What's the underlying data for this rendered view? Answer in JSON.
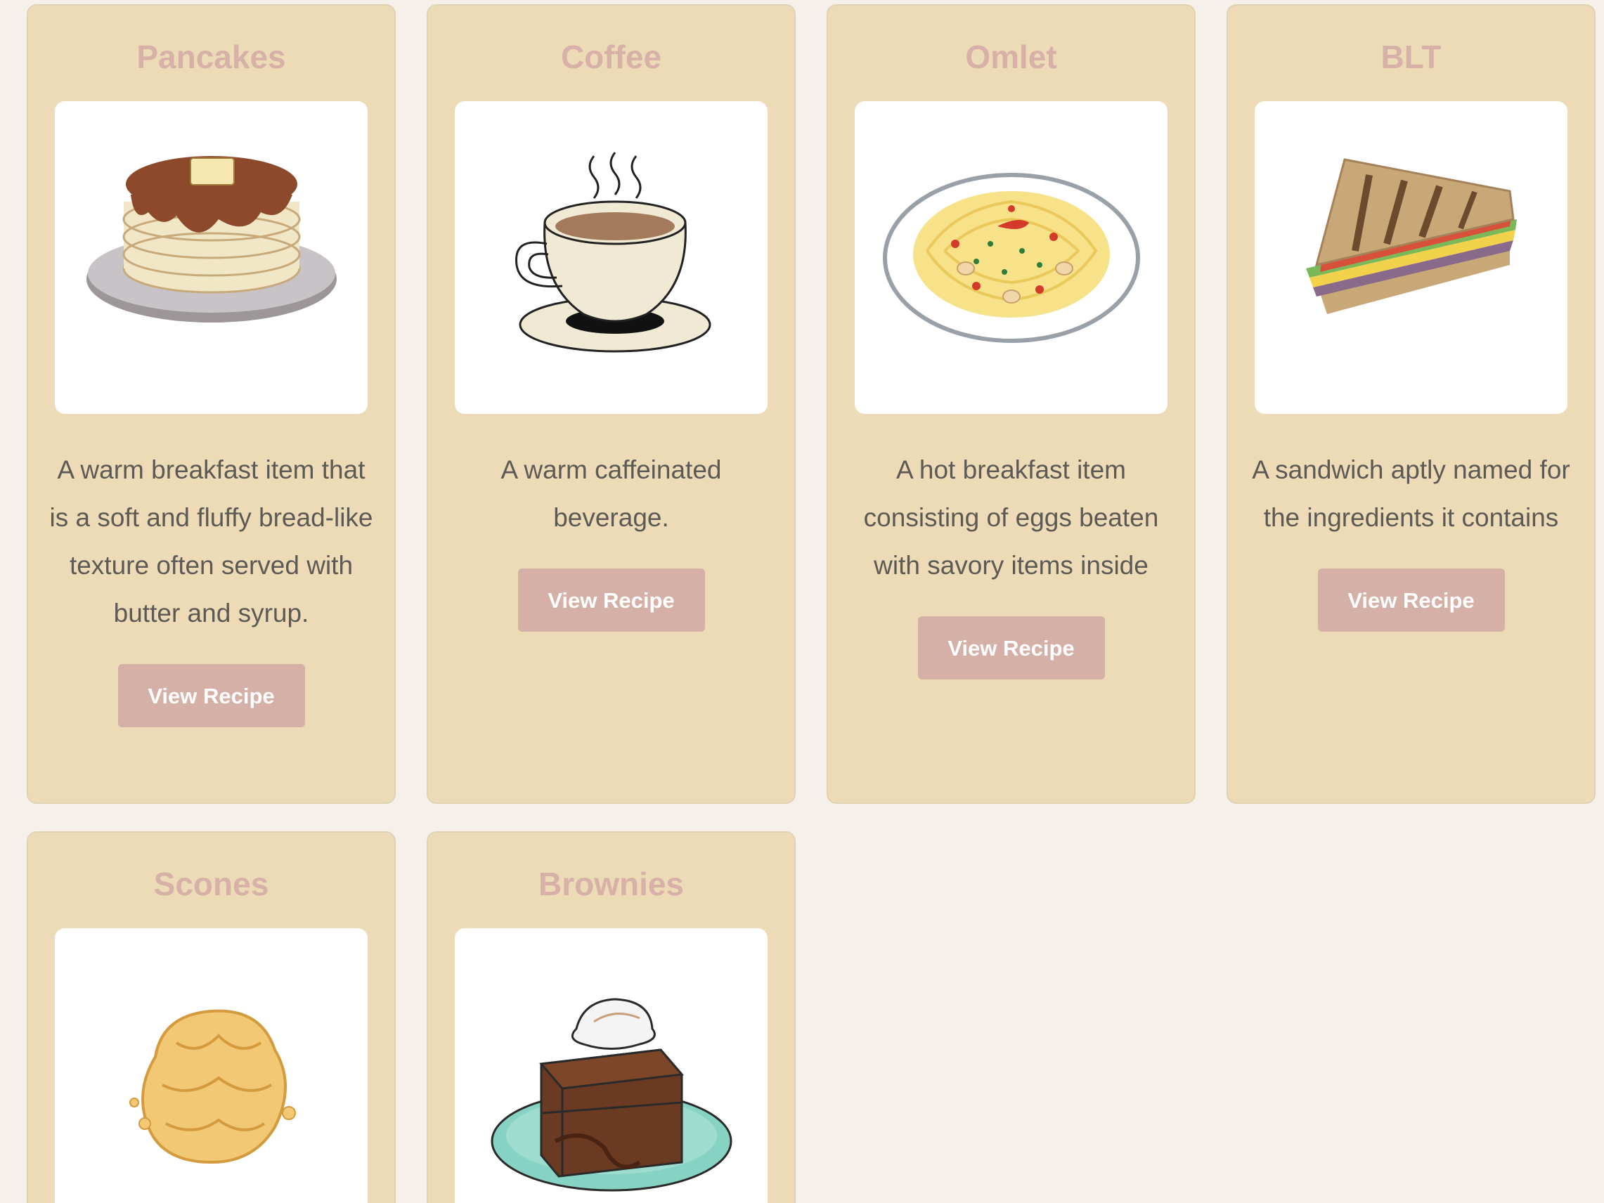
{
  "cards": [
    {
      "title": "Pancakes",
      "image_icon": "pancakes-icon",
      "description": "A warm breakfast item that is a soft and fluffy bread-like texture often served with butter and syrup.",
      "button_label": "View Recipe"
    },
    {
      "title": "Coffee",
      "image_icon": "coffee-cup-icon",
      "description": "A warm caffeinated beverage.",
      "button_label": "View Recipe"
    },
    {
      "title": "Omlet",
      "image_icon": "pasta-plate-icon",
      "description": "A hot breakfast item consisting of eggs beaten with savory items inside",
      "button_label": "View Recipe"
    },
    {
      "title": "BLT",
      "image_icon": "sandwich-icon",
      "description": "A sandwich aptly named for the ingredients it contains",
      "button_label": "View Recipe"
    },
    {
      "title": "Scones",
      "image_icon": "scone-icon",
      "description": "",
      "button_label": ""
    },
    {
      "title": "Brownies",
      "image_icon": "brownie-icon",
      "description": "",
      "button_label": ""
    }
  ],
  "colors": {
    "page_background": "#f5f1ea",
    "card_background": "#ecdbb6",
    "title_color": "#d7b0a7",
    "button_color": "#d4b0a6",
    "text_color": "#5d5a55"
  }
}
